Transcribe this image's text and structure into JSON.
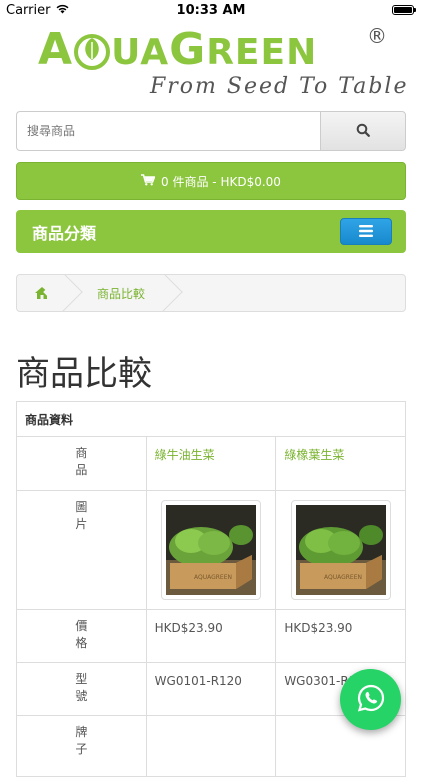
{
  "status_bar": {
    "carrier": "Carrier",
    "time": "10:33 AM"
  },
  "brand": {
    "name_letters": [
      "A",
      "Q",
      "UA",
      "G",
      "REEN"
    ],
    "name": "AQUAGREEN",
    "registered": "®",
    "tagline": "From Seed To Table",
    "color": "#8cc63f"
  },
  "search": {
    "placeholder": "搜尋商品",
    "icon": "search-icon"
  },
  "cart": {
    "text": "0 件商品 - HKD$0.00",
    "icon": "shopping-cart-icon"
  },
  "category_menu": {
    "title": "商品分類",
    "icon": "hamburger-menu-icon"
  },
  "breadcrumb": {
    "home_icon": "home-icon",
    "current": "商品比較"
  },
  "page_title": "商品比較",
  "compare": {
    "section_header": "商品資料",
    "labels": {
      "product": [
        "商",
        "品"
      ],
      "image": [
        "圖",
        "片"
      ],
      "price": [
        "價",
        "格"
      ],
      "model": [
        "型",
        "號"
      ],
      "brand": [
        "牌",
        "子"
      ]
    },
    "products": [
      {
        "name": "綠牛油生菜",
        "price": "HKD$23.90",
        "model": "WG0101-R120"
      },
      {
        "name": "綠橡葉生菜",
        "price": "HKD$23.90",
        "model": "WG0301-R120"
      }
    ]
  },
  "floating": {
    "icon": "whatsapp-icon"
  },
  "colors": {
    "accent_green": "#8cc63f",
    "menu_blue": "#2fa4e7",
    "whatsapp": "#25d366"
  }
}
